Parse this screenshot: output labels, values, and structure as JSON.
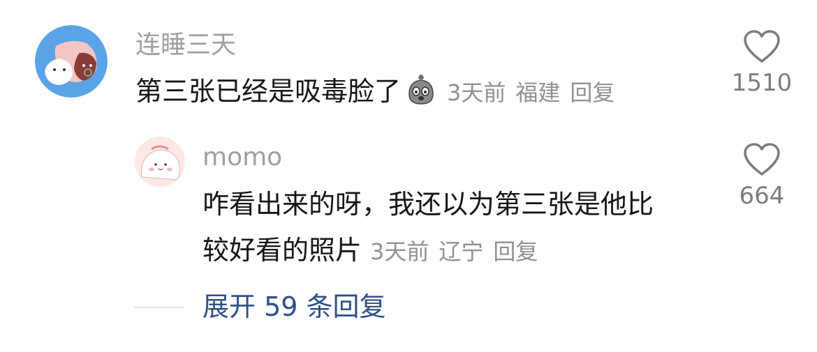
{
  "comment": {
    "username": "连睡三天",
    "text": "第三张已经是吸毒脸了",
    "emoji": "bag-face-emoji",
    "time": "3天前",
    "location": "福建",
    "reply_label": "回复",
    "likes": "1510"
  },
  "reply": {
    "username": "momo",
    "text_line1": "咋看出来的呀，我还以为第三张是他比",
    "text_line2": "较好看的照片",
    "time": "3天前",
    "location": "辽宁",
    "reply_label": "回复",
    "likes": "664"
  },
  "expand_label": "展开 59 条回复",
  "colors": {
    "username": "#9e9ea3",
    "text": "#161616",
    "meta": "#8f8f94",
    "expand": "#2f4f86",
    "avatar1_bg": "#5aa3e6",
    "avatar2_bg": "#fde8e6"
  }
}
